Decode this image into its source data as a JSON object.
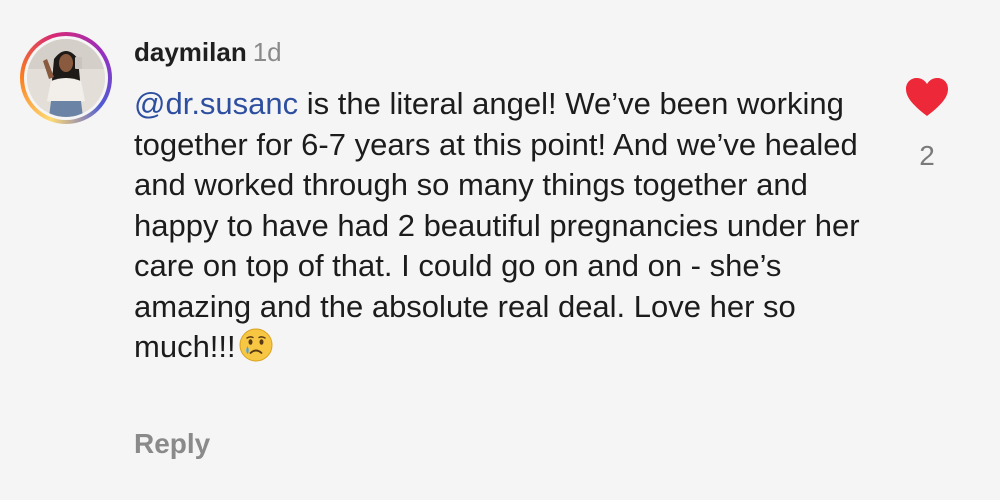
{
  "comment": {
    "username": "daymilan",
    "time_ago": "1d",
    "mention": "@dr.susanc",
    "text": " is the literal angel! We’ve been working together for 6-7 years at this point! And we’ve healed and worked through so many things together and happy to have had 2 beautiful pregnancies under her care on top of that. I could go on and on - she’s amazing and the absolute real deal. Love her so much!!!",
    "emoji": "crying-face-emoji",
    "reply_label": "Reply",
    "like_count": "2",
    "liked": true
  },
  "colors": {
    "mention": "#2e4fa0",
    "heart": "#ed2939",
    "meta": "#8a8a8a",
    "background": "#f5f5f5"
  }
}
